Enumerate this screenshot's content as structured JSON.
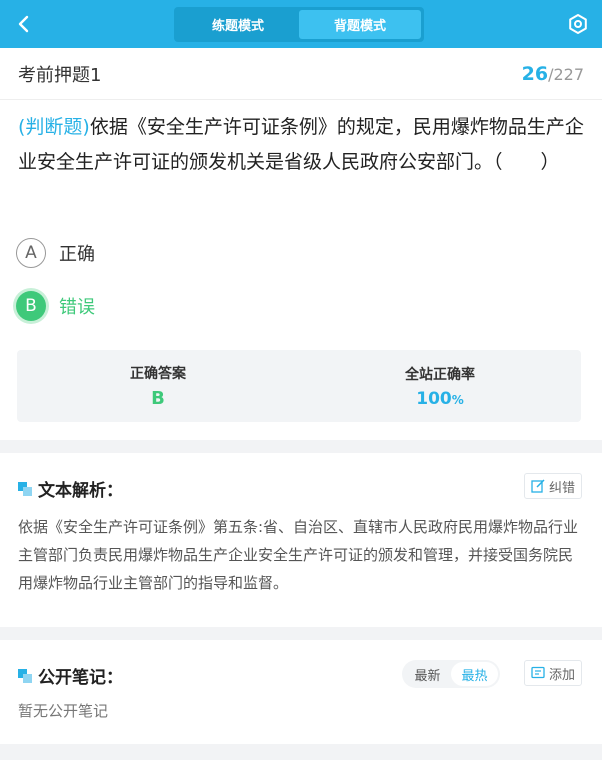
{
  "header": {
    "modes": [
      "练题模式",
      "背题模式"
    ],
    "active_mode": "背题模式"
  },
  "exam": {
    "title": "考前押题1",
    "current": "26",
    "separator": "/",
    "total": "227"
  },
  "question": {
    "type": "(判断题)",
    "text": "依据《安全生产许可证条例》的规定，民用爆炸物品生产企业安全生产许可证的颁发机关是省级人民政府公安部门。（　　）",
    "options": [
      {
        "letter": "A",
        "text": "正确",
        "correct": false
      },
      {
        "letter": "B",
        "text": "错误",
        "correct": true
      }
    ]
  },
  "answer": {
    "correct_label": "正确答案",
    "correct_value": "B",
    "rate_label": "全站正确率",
    "rate_value": "100",
    "rate_unit": "%"
  },
  "analysis": {
    "title": "文本解析：",
    "report_label": "纠错",
    "text": "依据《安全生产许可证条例》第五条:省、自治区、直辖市人民政府民用爆炸物品行业主管部门负责民用爆炸物品生产企业安全生产许可证的颁发和管理，并接受国务院民用爆炸物品行业主管部门的指导和监督。"
  },
  "notes": {
    "title": "公开笔记：",
    "sort_options": [
      "最新",
      "最热"
    ],
    "active_sort": "最热",
    "add_label": "添加",
    "empty_text": "暂无公开笔记"
  },
  "colors": {
    "accent": "#27b1e6",
    "correct": "#3ec97a"
  },
  "icons": [
    "back-icon",
    "settings-icon",
    "section-icon",
    "edit-icon",
    "note-icon"
  ]
}
